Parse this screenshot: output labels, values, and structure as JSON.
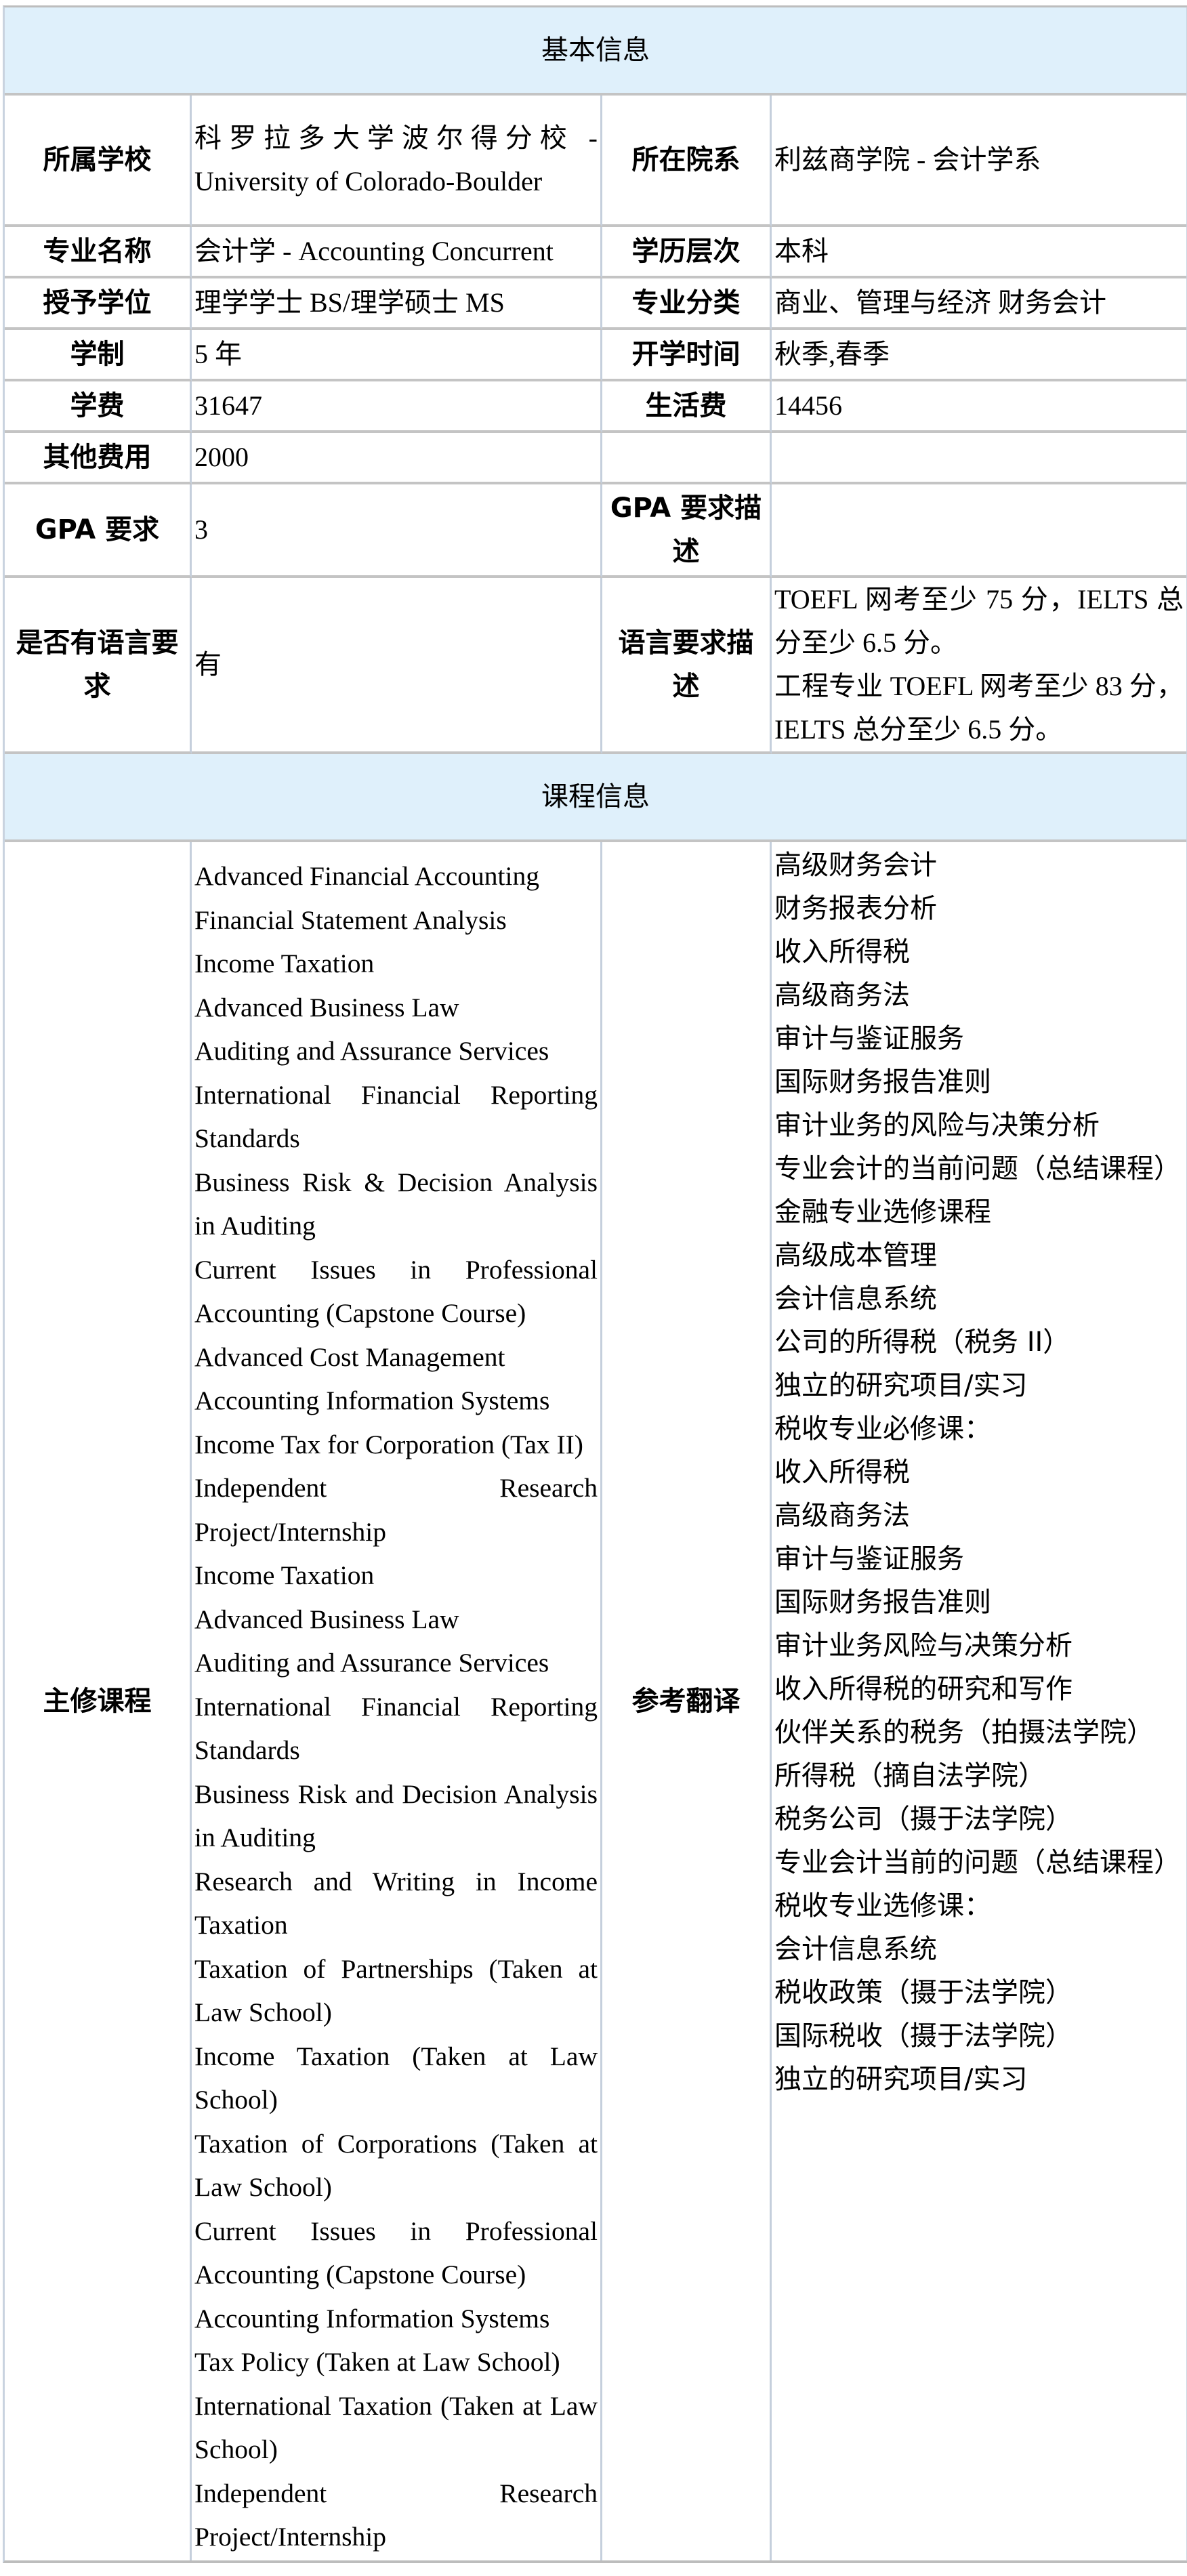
{
  "basic_info": {
    "section_title": "基本信息",
    "rows": [
      {
        "label1": "所属学校",
        "value1": "科罗拉多大学波尔得分校 - University of Colorado-Boulder",
        "label2": "所在院系",
        "value2": "利兹商学院 - 会计学系"
      },
      {
        "label1": "专业名称",
        "value1": "会计学 - Accounting Concurrent",
        "label2": "学历层次",
        "value2": "本科"
      },
      {
        "label1": "授予学位",
        "value1": "理学学士 BS/理学硕士 MS",
        "label2": "专业分类",
        "value2": "商业、管理与经济 财务会计"
      },
      {
        "label1": "学制",
        "value1": "5 年",
        "label2": "开学时间",
        "value2": "秋季,春季"
      },
      {
        "label1": "学费",
        "value1": "31647",
        "label2": "生活费",
        "value2": "14456"
      },
      {
        "label1": "其他费用",
        "value1": "2000",
        "label2": "",
        "value2": ""
      },
      {
        "label1": "GPA 要求",
        "value1": "3",
        "label2": "GPA 要求描述",
        "value2": ""
      },
      {
        "label1": "是否有语言要求",
        "value1": "有",
        "label2": "语言要求描述",
        "value2": "TOEFL 网考至少 75 分，IELTS 总分至少 6.5 分。",
        "value2_extra": "工程专业 TOEFL 网考至少 83 分，IELTS 总分至少 6.5 分。"
      }
    ]
  },
  "course_info": {
    "section_title": "课程信息",
    "major_courses_label": "主修课程",
    "translation_label": "参考翻译",
    "courses_en": [
      "Advanced Financial Accounting",
      "Financial Statement Analysis",
      "Income Taxation",
      "Advanced Business Law",
      "Auditing and Assurance Services",
      "International Financial Reporting Standards",
      "Business Risk & Decision Analysis in Auditing",
      "Current Issues in Professional Accounting (Capstone Course)",
      "Advanced Cost Management",
      "Accounting Information Systems",
      "Income Tax for Corporation (Tax II)",
      "Independent Research Project/Internship",
      "Income Taxation",
      "Advanced Business Law",
      "Auditing and Assurance Services",
      "International Financial Reporting Standards",
      "Business Risk and Decision Analysis in Auditing",
      "Research and Writing in Income Taxation",
      "Taxation of Partnerships (Taken at Law School)",
      "Income Taxation (Taken at Law School)",
      "Taxation of Corporations (Taken at Law School)",
      "Current Issues in Professional Accounting (Capstone Course)",
      "Accounting Information Systems",
      "Tax Policy (Taken at Law School)",
      "International Taxation (Taken at Law School)",
      "Independent Research Project/Internship"
    ],
    "courses_cn": [
      "高级财务会计",
      "财务报表分析",
      "收入所得税",
      "高级商务法",
      "审计与鉴证服务",
      "国际财务报告准则",
      "审计业务的风险与决策分析",
      "专业会计的当前问题（总结课程）",
      "金融专业选修课程",
      "高级成本管理",
      "会计信息系统",
      "公司的所得税（税务 II）",
      "独立的研究项目/实习",
      "税收专业必修课：",
      "收入所得税",
      "高级商务法",
      "审计与鉴证服务",
      "国际财务报告准则",
      "审计业务风险与决策分析",
      "收入所得税的研究和写作",
      "伙伴关系的税务（拍摄法学院）",
      "所得税（摘自法学院）",
      "税务公司（摄于法学院）",
      "专业会计当前的问题（总结课程）",
      "税收专业选修课：",
      "会计信息系统",
      "税收政策（摄于法学院）",
      "国际税收（摄于法学院）",
      "独立的研究项目/实习"
    ]
  }
}
